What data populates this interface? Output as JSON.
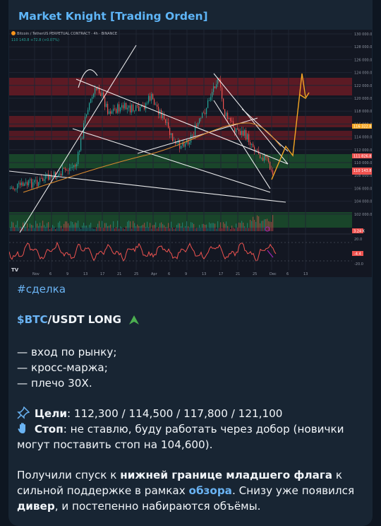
{
  "channel": {
    "title": "Market Knight [Trading Orden]"
  },
  "chart": {
    "symbol_line": "Bitcoin / TetherUS PERPETUAL CONTRACT · 4h · BINANCE",
    "price_line": "110 143.8 +72.8 (+0.07%)",
    "y_ticks": [
      "130 000.0",
      "128 000.0",
      "126 000.0",
      "124 000.0",
      "122 000.0",
      "120 000.0",
      "118 000.0",
      "116 000.0",
      "114 000.0",
      "112 000.0",
      "110 000.0",
      "108 000.0",
      "106 000.0",
      "104 000.0",
      "102 000.0"
    ],
    "x_ticks": [
      "Nov",
      "6",
      "9",
      "13",
      "17",
      "21",
      "25",
      "Apr",
      "6",
      "9",
      "13",
      "17",
      "21",
      "25",
      "Dec",
      "6",
      "13"
    ],
    "price_tags": [
      "116 322.8",
      "111 826.8",
      "110 143.8",
      "3.24 K"
    ],
    "osc_ticks": [
      "20.0",
      "-20.0"
    ],
    "osc_tag": "-4.4",
    "colors": {
      "up": "#26a69a",
      "down": "#ef5350",
      "resistance": "#7a1f28",
      "support": "#1e5a32",
      "projection": "#f5a623"
    }
  },
  "message": {
    "hashtag": "#сделка",
    "pair_ticker": "$BTC",
    "pair_rest": "/USDT LONG",
    "conditions": [
      "— вход по рынку;",
      "— кросс-маржа;",
      "— плечо 30X."
    ],
    "targets_label": "Цели",
    "targets_value": ": 112,300 / 114,500 / 117,800 / 121,100",
    "stop_label": "Стоп",
    "stop_value_line1": ": не ставлю, буду работать через добор (новички",
    "stop_value_line2": "могут поставить стоп на 104,600).",
    "para_a1": "Получили спуск к ",
    "para_b1": "нижней границе младшего флага",
    "para_a2": " к",
    "para_a3": "сильной поддержке в рамках ",
    "para_link": "обзора",
    "para_a4": ". Снизу уже появился",
    "para_b2": "дивер",
    "para_a5": ", и постепенно набираются объёмы."
  }
}
